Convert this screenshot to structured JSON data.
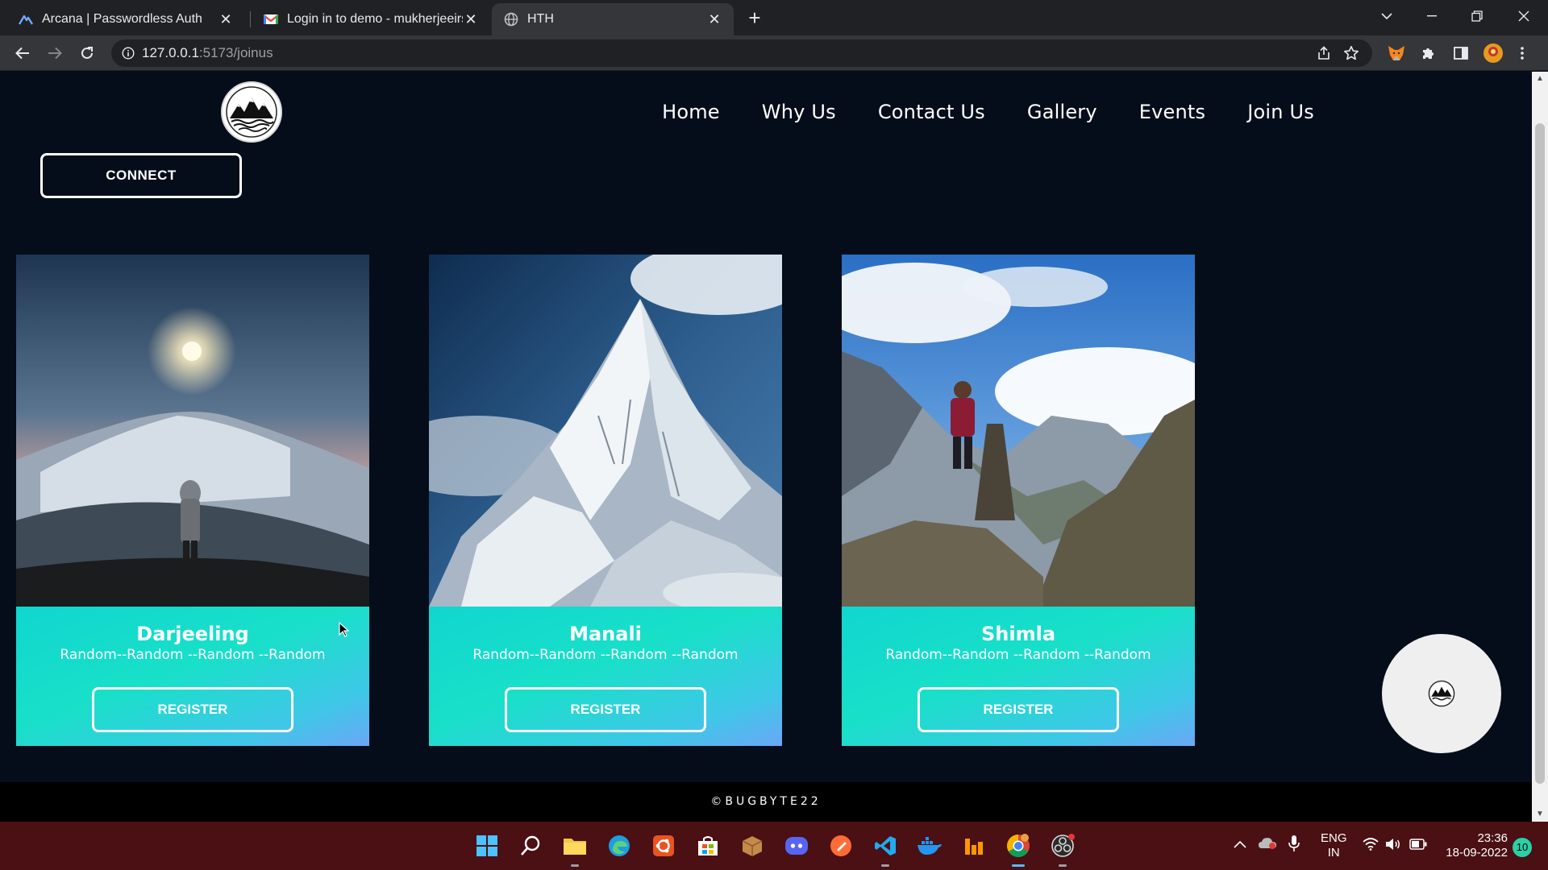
{
  "browser": {
    "tabs": [
      {
        "title": "Arcana | Passwordless Auth",
        "icon": "arcana-logo-icon",
        "active": false
      },
      {
        "title": "Login in to demo - mukherjeeirst",
        "icon": "gmail-icon",
        "active": false
      },
      {
        "title": "HTH",
        "icon": "globe-icon",
        "active": true
      }
    ],
    "url_host": "127.0.0.1",
    "url_path": ":5173/joinus"
  },
  "site": {
    "nav": [
      "Home",
      "Why Us",
      "Contact Us",
      "Gallery",
      "Events",
      "Join Us"
    ],
    "connect_label": "CONNECT",
    "cards": [
      {
        "name": "Darjeeling",
        "desc": "Random--Random --Random --Random",
        "button": "REGISTER"
      },
      {
        "name": "Manali",
        "desc": "Random--Random --Random --Random",
        "button": "REGISTER"
      },
      {
        "name": "Shimla",
        "desc": "Random--Random --Random --Random",
        "button": "REGISTER"
      }
    ],
    "footer": "©BUGBYTE22"
  },
  "taskbar": {
    "lang_line1": "ENG",
    "lang_line2": "IN",
    "time": "23:36",
    "date": "18-09-2022",
    "notifications": "10"
  },
  "colors": {
    "page_bg": "#050d1a",
    "card_gradient_start": "#10d6d0",
    "card_gradient_end": "#6aa7f5",
    "taskbar_bg": "#4a1014"
  }
}
